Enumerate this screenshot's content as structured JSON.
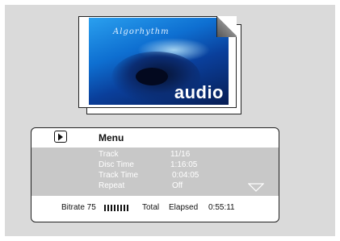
{
  "cover": {
    "title": "Algorhythm",
    "brand": "audio"
  },
  "menu": {
    "title": "Menu",
    "rows": [
      {
        "label": "Track",
        "value": "11/16"
      },
      {
        "label": "Disc Time",
        "value": "1:16:05"
      },
      {
        "label": "Track Time",
        "value": "0:04:05"
      },
      {
        "label": "Repeat",
        "value": "Off"
      }
    ]
  },
  "status": {
    "bitrate_label": "Bitrate 75",
    "bitrate_level": 0.7,
    "total_label": "Total",
    "elapsed_label": "Elapsed",
    "elapsed_value": "0:55:11"
  },
  "icons": {
    "play": "play-icon",
    "scroll": "chevron-down-icon"
  }
}
